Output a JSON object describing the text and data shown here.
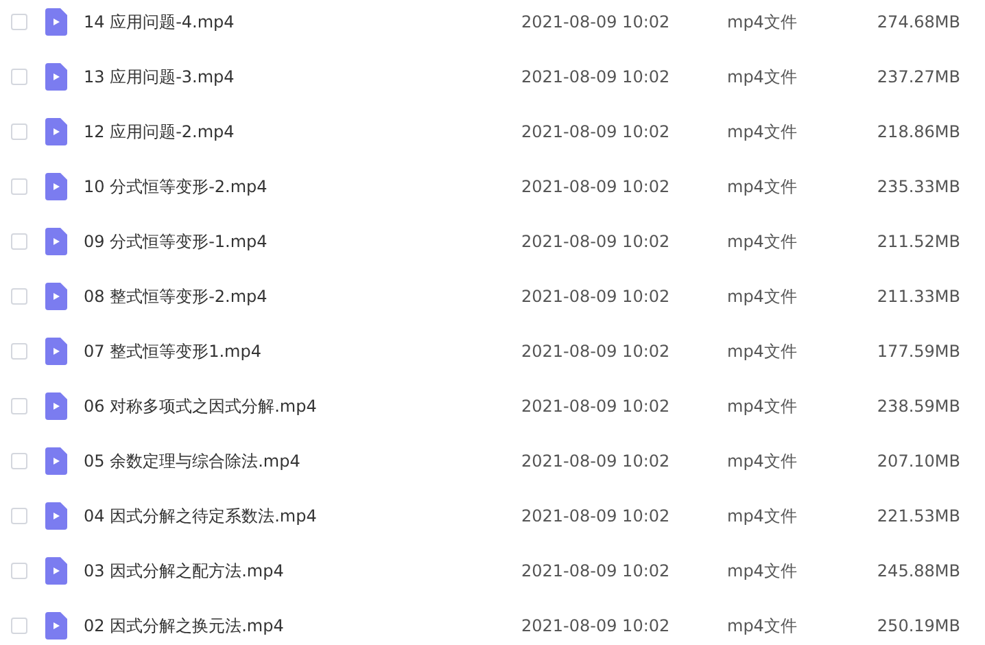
{
  "files": [
    {
      "name": "14 应用问题-4.mp4",
      "modified": "2021-08-09 10:02",
      "type": "mp4文件",
      "size": "274.68MB",
      "checked": false
    },
    {
      "name": "13 应用问题-3.mp4",
      "modified": "2021-08-09 10:02",
      "type": "mp4文件",
      "size": "237.27MB",
      "checked": false
    },
    {
      "name": "12 应用问题-2.mp4",
      "modified": "2021-08-09 10:02",
      "type": "mp4文件",
      "size": "218.86MB",
      "checked": false
    },
    {
      "name": "10 分式恒等变形-2.mp4",
      "modified": "2021-08-09 10:02",
      "type": "mp4文件",
      "size": "235.33MB",
      "checked": false
    },
    {
      "name": "09 分式恒等变形-1.mp4",
      "modified": "2021-08-09 10:02",
      "type": "mp4文件",
      "size": "211.52MB",
      "checked": false
    },
    {
      "name": "08 整式恒等变形-2.mp4",
      "modified": "2021-08-09 10:02",
      "type": "mp4文件",
      "size": "211.33MB",
      "checked": false
    },
    {
      "name": "07 整式恒等变形1.mp4",
      "modified": "2021-08-09 10:02",
      "type": "mp4文件",
      "size": "177.59MB",
      "checked": false
    },
    {
      "name": "06 对称多项式之因式分解.mp4",
      "modified": "2021-08-09 10:02",
      "type": "mp4文件",
      "size": "238.59MB",
      "checked": false
    },
    {
      "name": "05 余数定理与综合除法.mp4",
      "modified": "2021-08-09 10:02",
      "type": "mp4文件",
      "size": "207.10MB",
      "checked": false
    },
    {
      "name": "04 因式分解之待定系数法.mp4",
      "modified": "2021-08-09 10:02",
      "type": "mp4文件",
      "size": "221.53MB",
      "checked": false
    },
    {
      "name": "03 因式分解之配方法.mp4",
      "modified": "2021-08-09 10:02",
      "type": "mp4文件",
      "size": "245.88MB",
      "checked": false
    },
    {
      "name": "02 因式分解之换元法.mp4",
      "modified": "2021-08-09 10:02",
      "type": "mp4文件",
      "size": "250.19MB",
      "checked": false
    }
  ]
}
